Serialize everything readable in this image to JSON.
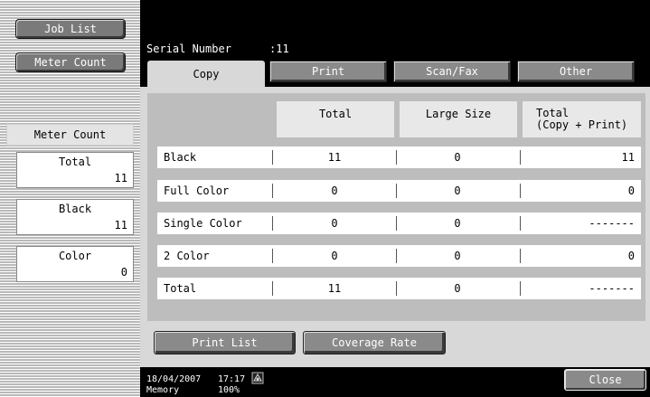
{
  "sidebar": {
    "job_list_label": "Job List",
    "meter_count_button_label": "Meter Count",
    "meter_count_header": "Meter Count",
    "counters": [
      {
        "label": "Total",
        "value": "11"
      },
      {
        "label": "Black",
        "value": "11"
      },
      {
        "label": "Color",
        "value": "0"
      }
    ]
  },
  "header": {
    "serial_label": "Serial Number",
    "serial_value": ":11"
  },
  "tabs": [
    {
      "label": "Copy",
      "active": true
    },
    {
      "label": "Print",
      "active": false
    },
    {
      "label": "Scan/Fax",
      "active": false
    },
    {
      "label": "Other",
      "active": false
    }
  ],
  "table": {
    "columns": [
      "Total",
      "Large Size",
      "Total\n(Copy + Print)"
    ],
    "rows": [
      {
        "label": "Black",
        "total": "11",
        "large_size": "0",
        "copy_print": "11"
      },
      {
        "label": "Full Color",
        "total": "0",
        "large_size": "0",
        "copy_print": "0"
      },
      {
        "label": "Single Color",
        "total": "0",
        "large_size": "0",
        "copy_print": "-------"
      },
      {
        "label": "2 Color",
        "total": "0",
        "large_size": "0",
        "copy_print": "0"
      },
      {
        "label": "Total",
        "total": "11",
        "large_size": "0",
        "copy_print": "-------"
      }
    ]
  },
  "buttons": {
    "print_list": "Print List",
    "coverage_rate": "Coverage Rate",
    "close": "Close"
  },
  "status": {
    "date": "18/04/2007",
    "time": "17:17",
    "memory_label": "Memory",
    "memory_value": "100%"
  },
  "icons": {
    "status_icon": "network-status-icon"
  },
  "colors": {
    "background": "#000000",
    "panel": "#d8d8d8",
    "button": "#8a8a8a"
  }
}
